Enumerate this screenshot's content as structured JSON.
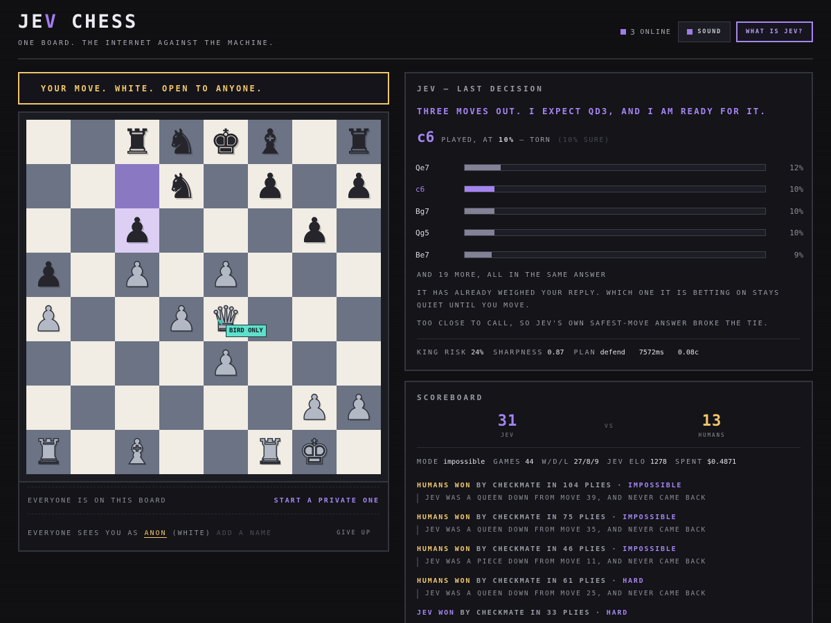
{
  "header": {
    "logo_a": "JE",
    "logo_b": "V",
    "logo_c": " CHESS",
    "tagline": "ONE BOARD. THE INTERNET AGAINST THE MACHINE.",
    "online_count": "3",
    "online_label": "ONLINE",
    "sound_label": "SOUND",
    "what_label": "WHAT IS JEV?"
  },
  "banner": "YOUR MOVE. WHITE. OPEN TO ANYONE.",
  "board": {
    "ranks": [
      [
        null,
        null,
        "bR",
        "bN",
        "bK",
        "bB",
        null,
        "bR"
      ],
      [
        null,
        null,
        null,
        "bN",
        null,
        "bP",
        null,
        "bP"
      ],
      [
        null,
        null,
        "bP",
        null,
        null,
        null,
        "bP",
        null
      ],
      [
        "bP",
        null,
        "wP",
        null,
        "wP",
        null,
        null,
        null
      ],
      [
        "wP",
        null,
        null,
        "wP",
        "wQ",
        null,
        null,
        null
      ],
      [
        null,
        null,
        null,
        null,
        "wP",
        null,
        null,
        null
      ],
      [
        null,
        null,
        null,
        null,
        null,
        null,
        "wP",
        "wP"
      ],
      [
        "wR",
        null,
        "wB",
        null,
        null,
        "wR",
        "wK",
        null
      ]
    ],
    "last_move_from": [
      1,
      2
    ],
    "last_move_to": [
      2,
      2
    ],
    "cursor_label": "BIRD ONLY"
  },
  "lobby": {
    "shared_text": "EVERYONE IS ON THIS BOARD",
    "private_link": "START A PRIVATE ONE",
    "sees_prefix": "EVERYONE SEES YOU AS",
    "name": "ANON",
    "color": "(WHITE)",
    "name_placeholder": "ADD A NAME",
    "give_up": "GIVE UP"
  },
  "decision": {
    "title": "JEV — LAST DECISION",
    "quote": "THREE MOVES OUT. I EXPECT QD3, AND I AM READY FOR IT.",
    "played_move": "c6",
    "played_prefix": "PLAYED, AT",
    "played_pct": "10%",
    "played_suffix": "— TORN",
    "sure": "(10% SURE)",
    "candidates": [
      {
        "move": "Qe7",
        "pct": "12%",
        "value": 0.12,
        "picked": false
      },
      {
        "move": "c6",
        "pct": "10%",
        "value": 0.1,
        "picked": true
      },
      {
        "move": "Bg7",
        "pct": "10%",
        "value": 0.1,
        "picked": false
      },
      {
        "move": "Qg5",
        "pct": "10%",
        "value": 0.1,
        "picked": false
      },
      {
        "move": "Be7",
        "pct": "9%",
        "value": 0.09,
        "picked": false
      }
    ],
    "more": "AND 19 MORE, ALL IN THE SAME ANSWER",
    "note1": "IT HAS ALREADY WEIGHED YOUR REPLY. WHICH ONE IT IS BETTING ON STAYS QUIET UNTIL YOU MOVE.",
    "note2": "TOO CLOSE TO CALL, SO JEV'S OWN SAFEST-MOVE ANSWER BROKE THE TIE.",
    "stats": {
      "king_risk_label": "KING RISK",
      "king_risk": "24%",
      "sharpness_label": "SHARPNESS",
      "sharpness": "0.87",
      "plan_label": "PLAN",
      "plan": "defend",
      "time": "7572ms",
      "cost": "0.08c"
    }
  },
  "scoreboard": {
    "title": "SCOREBOARD",
    "jev_score": "31",
    "jev_label": "JEV",
    "vs": "VS",
    "humans_score": "13",
    "humans_label": "HUMANS",
    "mode_label": "MODE",
    "mode": "impossible",
    "games_label": "GAMES",
    "games": "44",
    "wdl_label": "W/D/L",
    "wdl": "27/8/9",
    "elo_label": "JEV ELO",
    "elo": "1278",
    "spent_label": "SPENT",
    "spent": "$0.4871",
    "games_list": [
      {
        "who": "HUMANS WON",
        "how": "BY CHECKMATE IN 104 PLIES ·",
        "diff": "IMPOSSIBLE",
        "note": "JEV WAS A QUEEN DOWN FROM MOVE 39, AND NEVER CAME BACK",
        "side": "humans"
      },
      {
        "who": "HUMANS WON",
        "how": "BY CHECKMATE IN 75 PLIES ·",
        "diff": "IMPOSSIBLE",
        "note": "JEV WAS A QUEEN DOWN FROM MOVE 35, AND NEVER CAME BACK",
        "side": "humans"
      },
      {
        "who": "HUMANS WON",
        "how": "BY CHECKMATE IN 46 PLIES ·",
        "diff": "IMPOSSIBLE",
        "note": "JEV WAS A PIECE DOWN FROM MOVE 11, AND NEVER CAME BACK",
        "side": "humans"
      },
      {
        "who": "HUMANS WON",
        "how": "BY CHECKMATE IN 61 PLIES ·",
        "diff": "HARD",
        "note": "JEV WAS A QUEEN DOWN FROM MOVE 25, AND NEVER CAME BACK",
        "side": "humans"
      },
      {
        "who": "JEV WON",
        "how": "BY CHECKMATE IN 33 PLIES ·",
        "diff": "HARD",
        "note": "",
        "side": "jev"
      }
    ]
  },
  "colors": {
    "accent": "#a484f0",
    "gold": "#f2c76b",
    "light_square": "#f1ede4",
    "dark_square": "#6b7384"
  }
}
